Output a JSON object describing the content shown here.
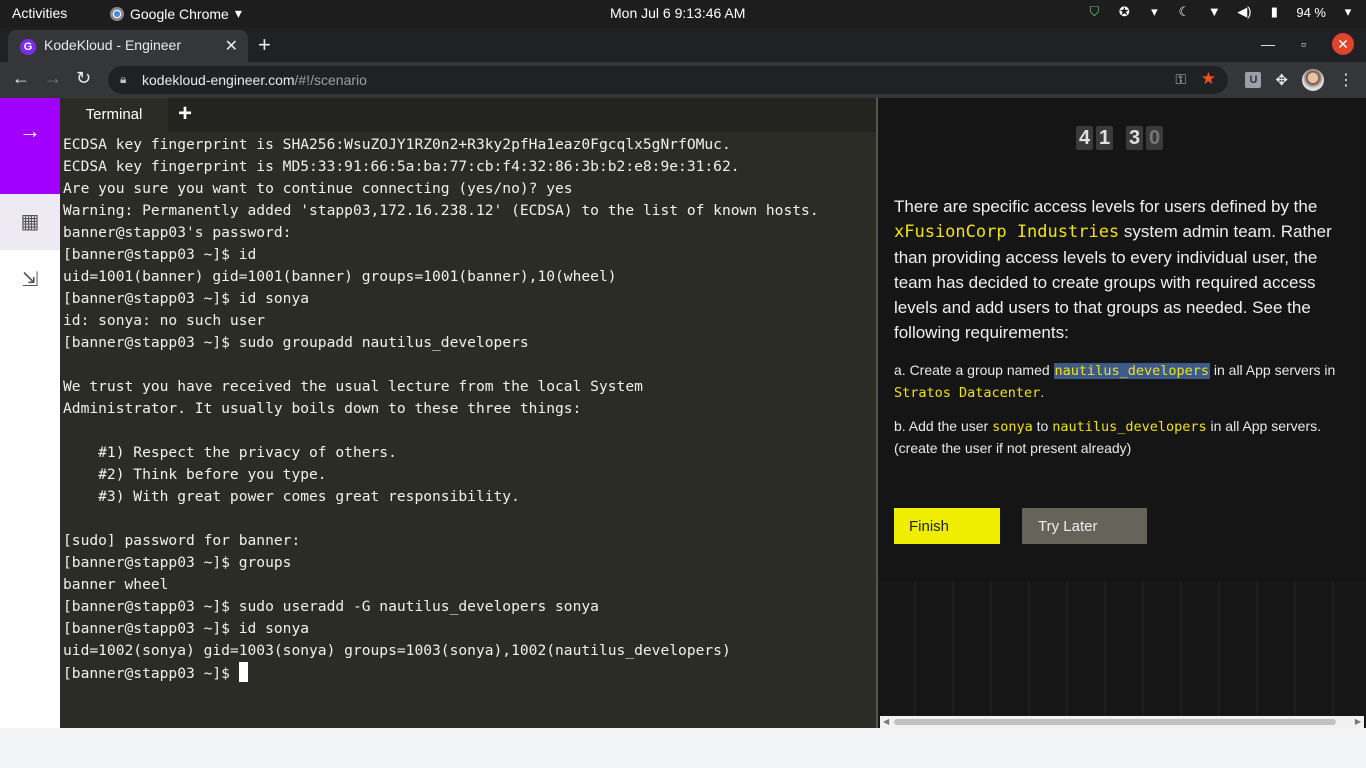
{
  "system_bar": {
    "activities": "Activities",
    "app_name": "Google Chrome",
    "clock": "Mon Jul 6   9:13:46 AM",
    "battery": "94 %"
  },
  "browser": {
    "tab_title": "KodeKloud - Engineer",
    "url_host": "kodekloud-engineer.com",
    "url_path": "/#!/scenario"
  },
  "terminal": {
    "tab_label": "Terminal",
    "lines": [
      "ECDSA key fingerprint is SHA256:WsuZOJY1RZ0n2+R3ky2pfHa1eaz0Fgcqlx5gNrfOMuc.",
      "ECDSA key fingerprint is MD5:33:91:66:5a:ba:77:cb:f4:32:86:3b:b2:e8:9e:31:62.",
      "Are you sure you want to continue connecting (yes/no)? yes",
      "Warning: Permanently added 'stapp03,172.16.238.12' (ECDSA) to the list of known hosts.",
      "banner@stapp03's password:",
      "[banner@stapp03 ~]$ id",
      "uid=1001(banner) gid=1001(banner) groups=1001(banner),10(wheel)",
      "[banner@stapp03 ~]$ id sonya",
      "id: sonya: no such user",
      "[banner@stapp03 ~]$ sudo groupadd nautilus_developers",
      "",
      "We trust you have received the usual lecture from the local System",
      "Administrator. It usually boils down to these three things:",
      "",
      "    #1) Respect the privacy of others.",
      "    #2) Think before you type.",
      "    #3) With great power comes great responsibility.",
      "",
      "[sudo] password for banner:",
      "[banner@stapp03 ~]$ groups",
      "banner wheel",
      "[banner@stapp03 ~]$ sudo useradd -G nautilus_developers sonya",
      "[banner@stapp03 ~]$ id sonya",
      "uid=1002(sonya) gid=1003(sonya) groups=1003(sonya),1002(nautilus_developers)"
    ],
    "prompt": "[banner@stapp03 ~]$ "
  },
  "task": {
    "timer_digits": [
      "4",
      "1",
      "3",
      "0"
    ],
    "intro_before": "There are specific access levels for users defined by the ",
    "company": "xFusionCorp Industries",
    "intro_after": " system admin team. Rather than providing access levels to every individual user, the team has decided to create groups with required access levels and add users to that groups as needed. See the following requirements:",
    "req_a_prefix": "a. Create a group named ",
    "req_a_group": "nautilus_developers",
    "req_a_mid": " in all App servers in ",
    "req_a_dc": "Stratos Datacenter",
    "req_a_end": ".",
    "req_b_prefix": "b. Add the user ",
    "req_b_user": "sonya",
    "req_b_to": " to ",
    "req_b_group": "nautilus_developers",
    "req_b_end": " in all App servers. (create the user if not present already)",
    "finish_label": "Finish",
    "try_later_label": "Try Later"
  }
}
